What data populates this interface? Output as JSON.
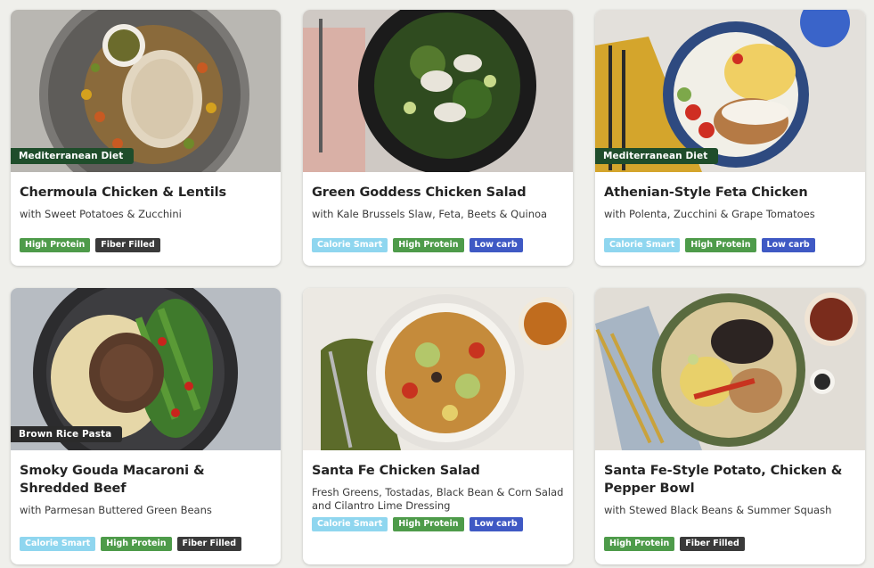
{
  "cards": [
    {
      "title": "Chermoula Chicken & Lentils",
      "subtitle": "with Sweet Potatoes & Zucchini",
      "diet_tag": "Mediterranean Diet",
      "badges": [
        "High Protein",
        "Fiber Filled"
      ]
    },
    {
      "title": "Green Goddess Chicken Salad",
      "subtitle": "with Kale Brussels Slaw, Feta, Beets & Quinoa",
      "diet_tag": "",
      "badges": [
        "Calorie Smart",
        "High Protein",
        "Low carb"
      ]
    },
    {
      "title": "Athenian-Style Feta Chicken",
      "subtitle": "with Polenta, Zucchini & Grape Tomatoes",
      "diet_tag": "Mediterranean Diet",
      "badges": [
        "Calorie Smart",
        "High Protein",
        "Low carb"
      ]
    },
    {
      "title": "Smoky Gouda Macaroni & Shredded Beef",
      "subtitle": "with Parmesan Buttered Green Beans",
      "diet_tag": "Brown Rice Pasta",
      "badges": [
        "Calorie Smart",
        "High Protein",
        "Fiber Filled"
      ]
    },
    {
      "title": "Santa Fe Chicken Salad",
      "subtitle": "Fresh Greens, Tostadas, Black Bean & Corn Salad and Cilantro Lime Dressing",
      "diet_tag": "",
      "badges": [
        "Calorie Smart",
        "High Protein",
        "Low carb"
      ]
    },
    {
      "title": "Santa Fe-Style Potato, Chicken & Pepper Bowl",
      "subtitle": "with Stewed Black Beans & Summer Squash",
      "diet_tag": "",
      "badges": [
        "High Protein",
        "Fiber Filled"
      ]
    }
  ],
  "colors": {
    "diet_tag_green": "#1f4d2b",
    "diet_tag_dark": "#2b2b2b",
    "calorie_smart": "#8fd6ef",
    "high_protein": "#4e9b4a",
    "fiber_filled": "#3a3a3a",
    "low_carb": "#3f59c4"
  }
}
